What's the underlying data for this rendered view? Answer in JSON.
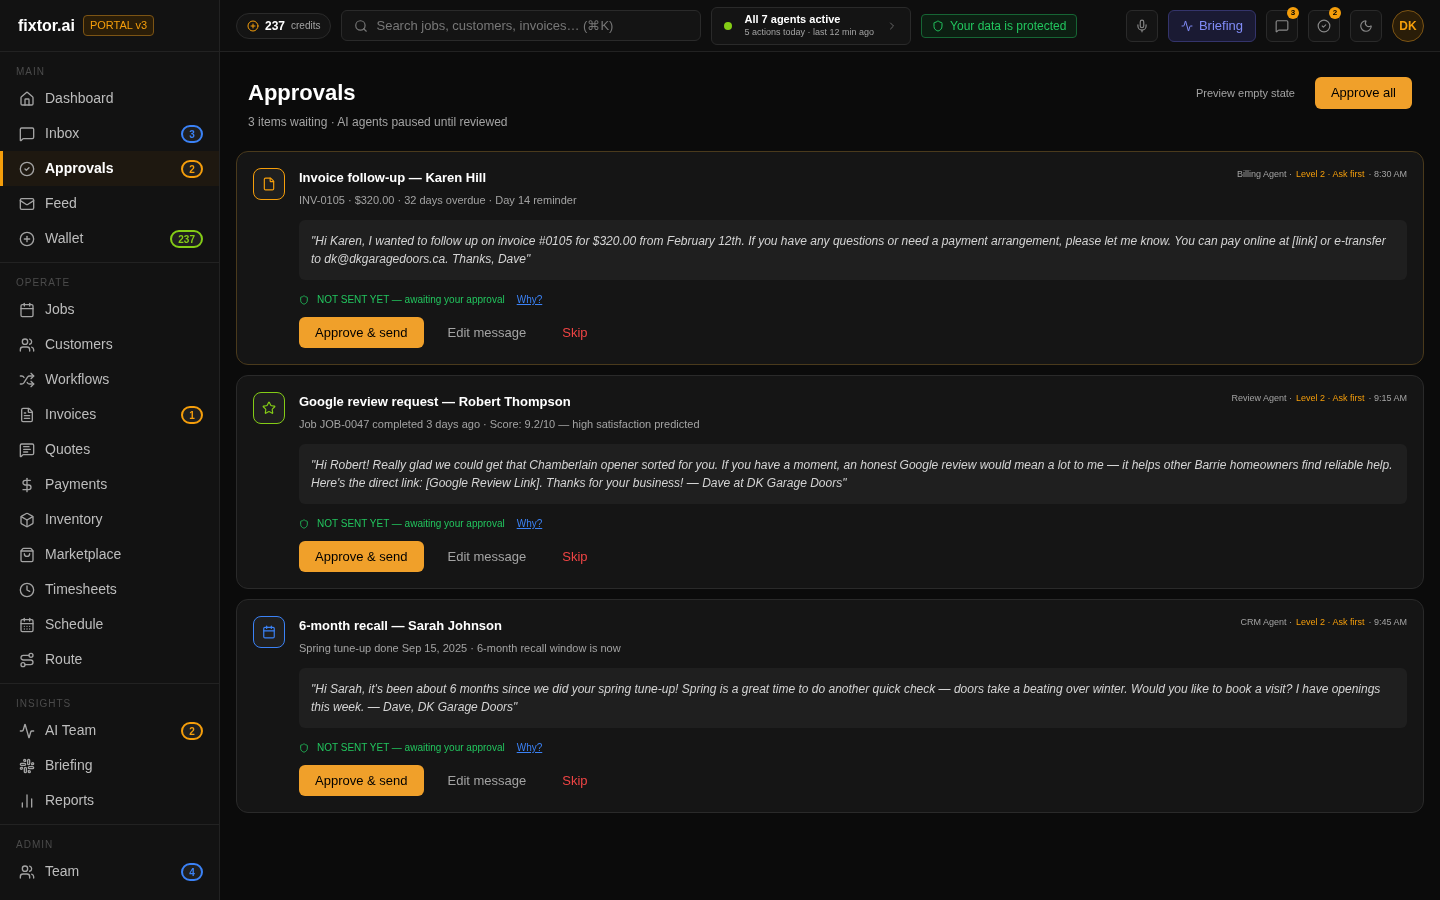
{
  "brand": {
    "name": "fixtor.ai",
    "tag": "PORTAL v3"
  },
  "topbar": {
    "credits": {
      "value": "237",
      "label": "credits"
    },
    "search": {
      "placeholder": "Search jobs, customers, invoices… (⌘K)"
    },
    "agents": {
      "title": "All 7 agents active",
      "subtitle": "5 actions today · last 12 min ago"
    },
    "protected": "Your data is protected",
    "briefing": "Briefing",
    "messages_count": "3",
    "approvals_count": "2",
    "avatar": "DK"
  },
  "sidebar": {
    "sections": [
      {
        "title": "MAIN",
        "items": [
          {
            "label": "Dashboard",
            "selected": false
          },
          {
            "label": "Inbox",
            "badge": "3",
            "color": "#3b82f6",
            "selected": false
          },
          {
            "label": "Approvals",
            "badge": "2",
            "color": "#f59e0b",
            "selected": true
          },
          {
            "label": "Feed",
            "selected": false
          },
          {
            "label": "Wallet",
            "badge": "237",
            "color": "#84cc16",
            "selected": false
          }
        ]
      },
      {
        "title": "OPERATE",
        "items": [
          {
            "label": "Jobs",
            "selected": false
          },
          {
            "label": "Customers",
            "selected": false
          },
          {
            "label": "Workflows",
            "selected": false
          },
          {
            "label": "Invoices",
            "badge": "1",
            "color": "#f59e0b",
            "selected": false
          },
          {
            "label": "Quotes",
            "selected": false
          },
          {
            "label": "Payments",
            "selected": false
          },
          {
            "label": "Inventory",
            "selected": false
          },
          {
            "label": "Marketplace",
            "selected": false
          },
          {
            "label": "Timesheets",
            "selected": false
          },
          {
            "label": "Schedule",
            "selected": false
          },
          {
            "label": "Route",
            "selected": false
          }
        ]
      },
      {
        "title": "INSIGHTS",
        "items": [
          {
            "label": "AI Team",
            "badge": "2",
            "color": "#f59e0b",
            "selected": false
          },
          {
            "label": "Briefing",
            "selected": false
          },
          {
            "label": "Reports",
            "selected": false
          }
        ]
      },
      {
        "title": "ADMIN",
        "items": [
          {
            "label": "Team",
            "badge": "4",
            "color": "#3b82f6",
            "selected": false
          }
        ]
      }
    ]
  },
  "page": {
    "title": "Approvals",
    "subtitle": "3 items waiting · AI agents paused until reviewed",
    "preview_link": "Preview empty state",
    "approve_all": "Approve all"
  },
  "approvals": [
    {
      "kind": "invoice",
      "color": "#f59e0b",
      "title": "Invoice follow-up — Karen Hill",
      "details": "INV-0105 · $320.00 · 32 days overdue · Day 14 reminder",
      "agent": "Billing Agent ·",
      "level": "Level 2 · Ask first",
      "time": "· 8:30 AM",
      "message": "\"Hi Karen, I wanted to follow up on invoice #0105 for $320.00 from February 12th. If you have any questions or need a payment arrangement, please let me know. You can pay online at [link] or e-transfer to dk@dkgaragedoors.ca. Thanks, Dave\"",
      "status": "NOT SENT YET — awaiting your approval",
      "why": "Why?",
      "approve": "Approve & send",
      "edit": "Edit message",
      "skip": "Skip",
      "highlighted": true
    },
    {
      "kind": "review",
      "color": "#84cc16",
      "title": "Google review request — Robert Thompson",
      "details": "Job JOB-0047 completed 3 days ago · Score: 9.2/10 — high satisfaction predicted",
      "agent": "Review Agent ·",
      "level": "Level 2 · Ask first",
      "time": "· 9:15 AM",
      "message": "\"Hi Robert! Really glad we could get that Chamberlain opener sorted for you. If you have a moment, an honest Google review would mean a lot to me — it helps other Barrie homeowners find reliable help. Here's the direct link: [Google Review Link]. Thanks for your business! — Dave at DK Garage Doors\"",
      "status": "NOT SENT YET — awaiting your approval",
      "why": "Why?",
      "approve": "Approve & send",
      "edit": "Edit message",
      "skip": "Skip",
      "highlighted": false
    },
    {
      "kind": "recall",
      "color": "#3b82f6",
      "title": "6-month recall — Sarah Johnson",
      "details": "Spring tune-up done Sep 15, 2025 · 6-month recall window is now",
      "agent": "CRM Agent ·",
      "level": "Level 2 · Ask first",
      "time": "· 9:45 AM",
      "message": "\"Hi Sarah, it's been about 6 months since we did your spring tune-up! Spring is a great time to do another quick check — doors take a beating over winter. Would you like to book a visit? I have openings this week. — Dave, DK Garage Doors\"",
      "status": "NOT SENT YET — awaiting your approval",
      "why": "Why?",
      "approve": "Approve & send",
      "edit": "Edit message",
      "skip": "Skip",
      "highlighted": false
    }
  ]
}
